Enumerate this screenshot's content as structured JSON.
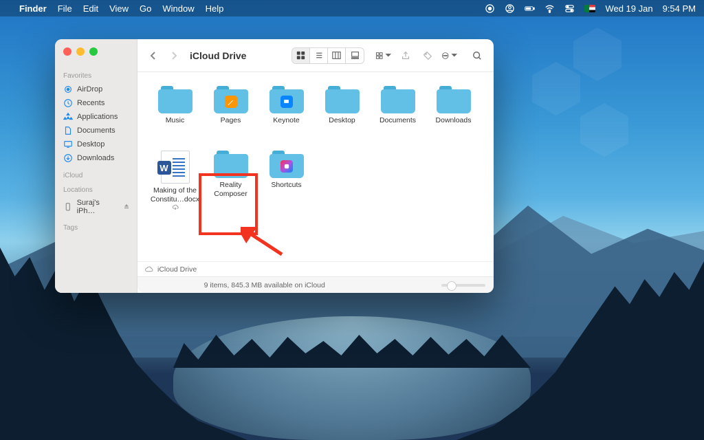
{
  "menubar": {
    "app_name": "Finder",
    "menus": [
      "File",
      "Edit",
      "View",
      "Go",
      "Window",
      "Help"
    ],
    "date": "Wed 19 Jan",
    "time": "9:54 PM"
  },
  "window": {
    "title": "iCloud Drive",
    "sidebar": {
      "sections": [
        {
          "header": "Favorites",
          "items": [
            {
              "label": "AirDrop",
              "icon": "airdrop-icon",
              "color": "#1e90ff"
            },
            {
              "label": "Recents",
              "icon": "clock-icon",
              "color": "#1e90ff"
            },
            {
              "label": "Applications",
              "icon": "apps-icon",
              "color": "#1e90ff"
            },
            {
              "label": "Documents",
              "icon": "doc-icon",
              "color": "#1e90ff"
            },
            {
              "label": "Desktop",
              "icon": "desktop-icon",
              "color": "#1e90ff"
            },
            {
              "label": "Downloads",
              "icon": "downloads-icon",
              "color": "#1e90ff"
            }
          ]
        },
        {
          "header": "iCloud",
          "items": []
        },
        {
          "header": "Locations",
          "items": [
            {
              "label": "Suraj's iPh…",
              "icon": "iphone-icon",
              "color": "#888"
            }
          ]
        },
        {
          "header": "Tags",
          "items": []
        }
      ]
    },
    "folders_row1": [
      {
        "label": "Music",
        "badge": null
      },
      {
        "label": "Pages",
        "badge": "pages"
      },
      {
        "label": "Keynote",
        "badge": "keynote"
      },
      {
        "label": "Desktop",
        "badge": null
      },
      {
        "label": "Documents",
        "badge": null
      },
      {
        "label": "Downloads",
        "badge": null
      }
    ],
    "row2": [
      {
        "type": "doc",
        "label": "Making of the Constitu…docx",
        "cloud": true
      },
      {
        "type": "folder",
        "label": "Reality Composer",
        "badge": null
      },
      {
        "type": "folder",
        "label": "Shortcuts",
        "badge": "shortcuts"
      }
    ],
    "pathbar": "iCloud Drive",
    "status": "9 items, 845.3 MB available on iCloud"
  }
}
